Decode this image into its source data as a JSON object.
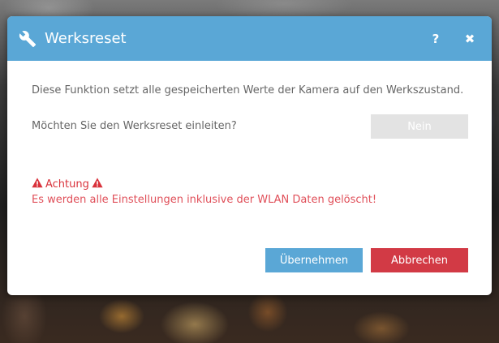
{
  "dialog": {
    "title": "Werksreset",
    "help_label": "?",
    "close_label": "✖",
    "description": "Diese Funktion setzt alle gespeicherten Werte der Kamera auf den Werkszustand.",
    "question": "Möchten Sie den Werksreset einleiten?",
    "toggle_value": "Nein",
    "warning_title": "Achtung",
    "warning_text": "Es werden alle Einstellungen inklusive der WLAN Daten gelöscht!",
    "apply_label": "Übernehmen",
    "cancel_label": "Abbrechen"
  },
  "colors": {
    "header": "#5aa7d6",
    "apply": "#5aa7d6",
    "cancel": "#d23a45",
    "warning": "#d9323b",
    "toggle": "#e3e3e3"
  },
  "icons": {
    "title_icon": "wrench-icon",
    "warning_icon": "warning-triangle-icon"
  }
}
